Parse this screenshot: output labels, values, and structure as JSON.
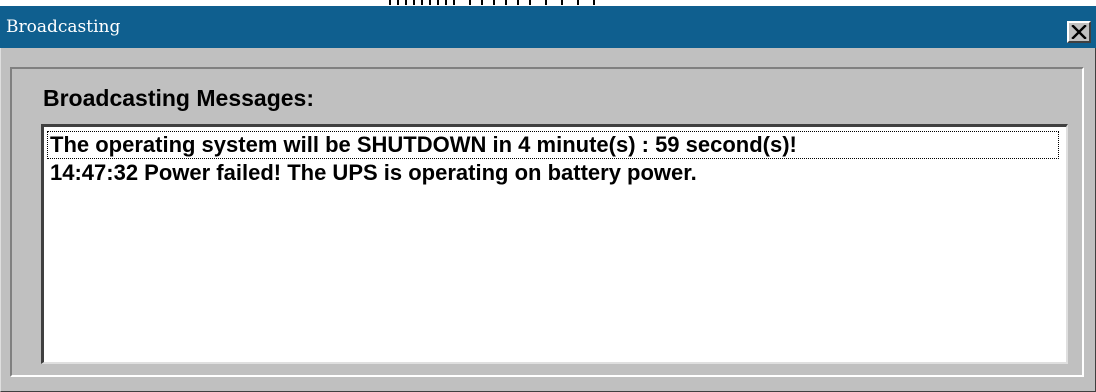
{
  "window": {
    "title": "Broadcasting"
  },
  "group": {
    "label": "Broadcasting Messages:"
  },
  "messages": [
    "The operating system will be SHUTDOWN in 4 minute(s) : 59 second(s)!",
    "14:47:32  Power failed! The UPS is operating on battery power."
  ],
  "colors": {
    "titlebar": "#0f5f8f",
    "window_face": "#c0c0c0",
    "list_background": "#ffffff"
  },
  "icons": {
    "close": "close-icon"
  }
}
